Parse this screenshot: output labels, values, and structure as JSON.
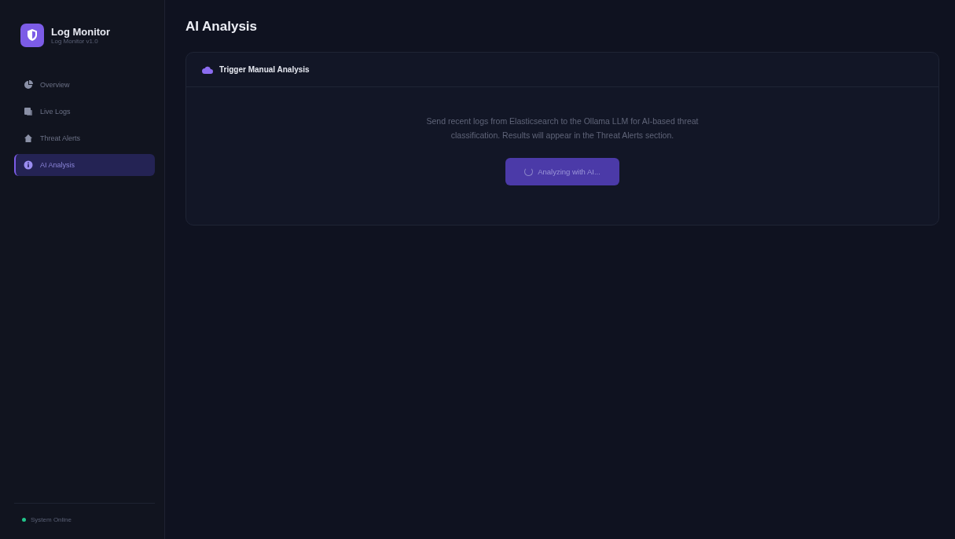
{
  "brand": {
    "title": "Log Monitor",
    "subtitle": "Log Monitor v1.0"
  },
  "nav": [
    {
      "label": "Overview",
      "selected": false
    },
    {
      "label": "Live Logs",
      "selected": false
    },
    {
      "label": "Threat Alerts",
      "selected": false
    },
    {
      "label": "AI Analysis",
      "selected": true
    }
  ],
  "status": {
    "label": "System Online",
    "online": true
  },
  "page_title": "AI Analysis",
  "card": {
    "title": "Trigger Manual Analysis",
    "description": "Send recent logs from Elasticsearch to the Ollama LLM for AI-based threat classification. Results will appear in the Threat Alerts section.",
    "button": {
      "label": "Analyzing with AI...",
      "loading": true
    }
  }
}
